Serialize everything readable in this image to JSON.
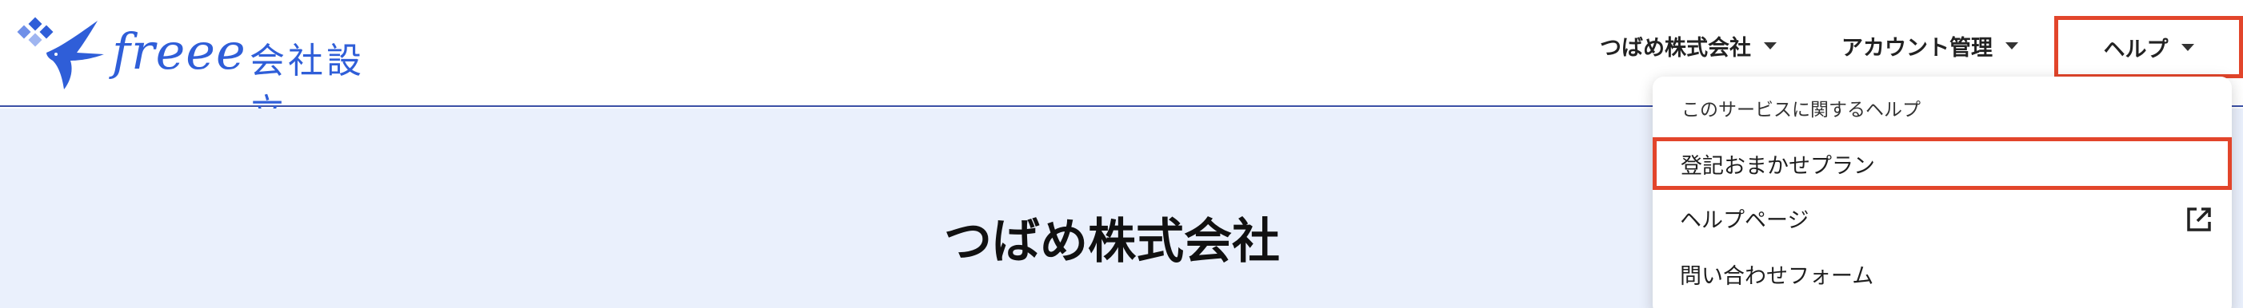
{
  "header": {
    "logo": {
      "brand": "freee",
      "product": "会社設立"
    },
    "nav": {
      "company": "つばめ株式会社",
      "account": "アカウント管理",
      "help": "ヘルプ"
    }
  },
  "main": {
    "company_name": "つばめ株式会社"
  },
  "help_menu": {
    "heading": "このサービスに関するヘルプ",
    "items": [
      {
        "label": "登記おまかせプラン",
        "icon": ""
      },
      {
        "label": "ヘルプページ",
        "icon": "external-link-icon"
      },
      {
        "label": "問い合わせフォーム",
        "icon": ""
      }
    ]
  },
  "colors": {
    "brand_blue": "#2f5ed8",
    "highlight_red": "#e2452b",
    "content_bg": "#eaf0fc",
    "header_border": "#3a4fa6"
  }
}
